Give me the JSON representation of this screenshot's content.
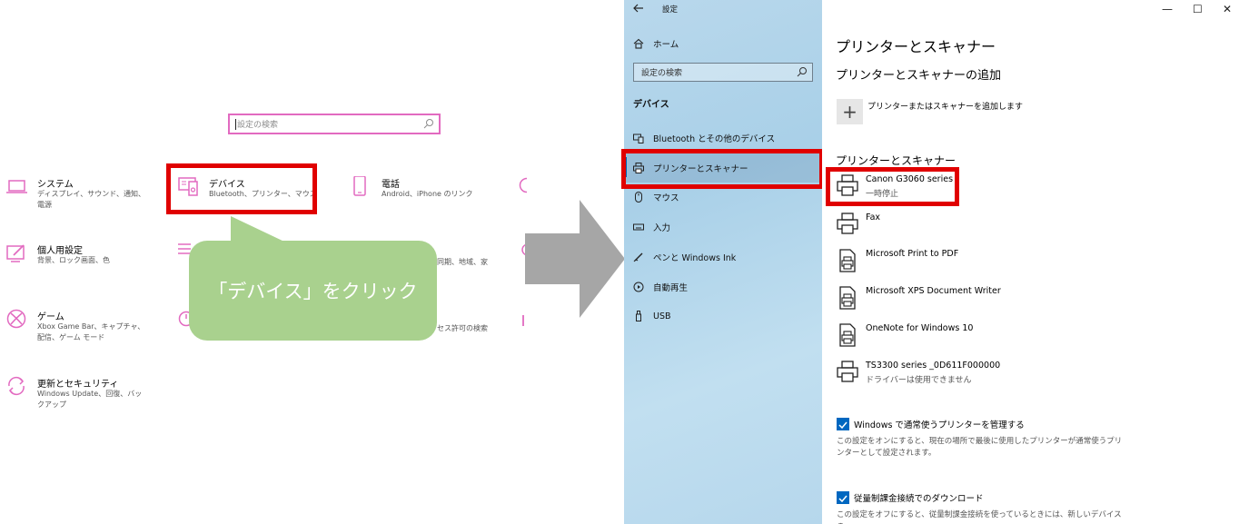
{
  "home": {
    "search_placeholder": "設定の検索",
    "tiles": {
      "system": {
        "title": "システム",
        "subtitle": "ディスプレイ、サウンド、通知、電源",
        "icon": "laptop-icon"
      },
      "devices": {
        "title": "デバイス",
        "subtitle": "Bluetooth、プリンター、マウス",
        "icon": "devices-icon"
      },
      "phone": {
        "title": "電話",
        "subtitle": "Android、iPhone のリンク",
        "icon": "phone-icon"
      },
      "personalization": {
        "title": "個人用設定",
        "subtitle": "背景、ロック画面、色",
        "icon": "personalization-icon"
      },
      "gaming": {
        "title": "ゲーム",
        "subtitle": "Xbox Game Bar、キャプチャ、配信、ゲーム モード",
        "icon": "xbox-icon"
      },
      "update": {
        "title": "更新とセキュリティ",
        "subtitle": "Windows Update、回復、バックアップ",
        "icon": "update-icon"
      }
    },
    "partial_texts": {
      "time": "同期、地域、家",
      "privacy": "セス許可の検索"
    }
  },
  "callout": {
    "text": "「デバイス」をクリック"
  },
  "settings_window": {
    "title": "設定",
    "back_icon": "back-arrow-icon",
    "nav": {
      "home": "ホーム",
      "search_placeholder": "設定の検索",
      "section": "デバイス",
      "items": [
        {
          "label": "Bluetooth とその他のデバイス",
          "icon": "bluetooth-icon"
        },
        {
          "label": "プリンターとスキャナー",
          "icon": "printer-icon",
          "selected": true
        },
        {
          "label": "マウス",
          "icon": "mouse-icon"
        },
        {
          "label": "入力",
          "icon": "keyboard-icon"
        },
        {
          "label": "ペンと Windows Ink",
          "icon": "pen-icon"
        },
        {
          "label": "自動再生",
          "icon": "autoplay-icon"
        },
        {
          "label": "USB",
          "icon": "usb-icon"
        }
      ]
    },
    "window_controls": {
      "minimize": "—",
      "maximize": "☐",
      "close": "✕"
    },
    "page_title": "プリンターとスキャナー",
    "add_section_title": "プリンターとスキャナーの追加",
    "add_button_label": "プリンターまたはスキャナーを追加します",
    "list_title": "プリンターとスキャナー",
    "printers": [
      {
        "name": "Canon G3060 series",
        "status": "一時停止",
        "icon": "printer-icon"
      },
      {
        "name": "Fax",
        "status": "",
        "icon": "printer-icon"
      },
      {
        "name": "Microsoft Print to PDF",
        "status": "",
        "icon": "document-printer-icon"
      },
      {
        "name": "Microsoft XPS Document Writer",
        "status": "",
        "icon": "document-printer-icon"
      },
      {
        "name": "OneNote for Windows 10",
        "status": "",
        "icon": "document-printer-icon"
      },
      {
        "name": "TS3300 series _0D611F000000",
        "status": "ドライバーは使用できません",
        "icon": "printer-icon"
      }
    ],
    "option_default": {
      "label": "Windows で通常使うプリンターを管理する",
      "checked": true,
      "description": "この設定をオンにすると、現在の場所で最後に使用したプリンターが通常使うプリンターとして設定されます。"
    },
    "option_metered": {
      "label": "従量制課金接続でのダウンロード",
      "checked": true,
      "description": "この設定をオフにすると、従量制課金接続を使っているときには、新しいデバイスの"
    }
  },
  "colors": {
    "highlight_red": "#e00000",
    "accent_pink": "#e26ac0",
    "callout_green": "#a9d18e",
    "checkbox_blue": "#0067c0",
    "arrow_gray": "#a6a6a6"
  }
}
